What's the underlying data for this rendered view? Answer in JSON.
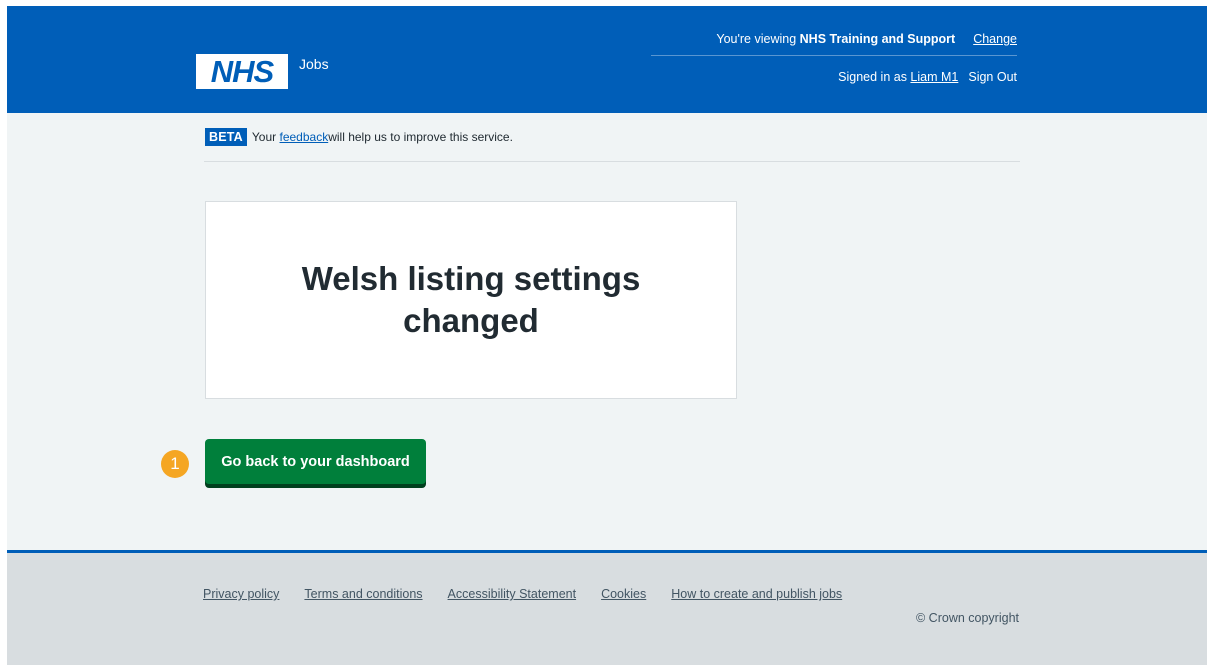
{
  "header": {
    "logo_text": "NHS",
    "service_name": "Jobs",
    "viewing_prefix": "You're viewing ",
    "organisation": "NHS Training and Support",
    "change_link": "Change",
    "signed_in_prefix": "Signed in as ",
    "user_name": "Liam M1",
    "sign_out": "Sign Out"
  },
  "beta_banner": {
    "tag": "BETA",
    "text_before": "Your ",
    "link": "feedback",
    "text_after": " will help us to improve this service."
  },
  "confirmation": {
    "title": "Welsh listing settings changed"
  },
  "actions": {
    "callout_number": "1",
    "dashboard_button": "Go back to your dashboard"
  },
  "footer": {
    "links": [
      "Privacy policy",
      "Terms and conditions",
      "Accessibility Statement",
      "Cookies",
      "How to create and publish jobs"
    ],
    "copyright": "© Crown copyright"
  },
  "colors": {
    "brand_blue": "#005eb8",
    "button_green": "#007f3b",
    "callout_orange": "#f5a623",
    "page_background": "#f0f4f5",
    "footer_background": "#d8dde0"
  }
}
